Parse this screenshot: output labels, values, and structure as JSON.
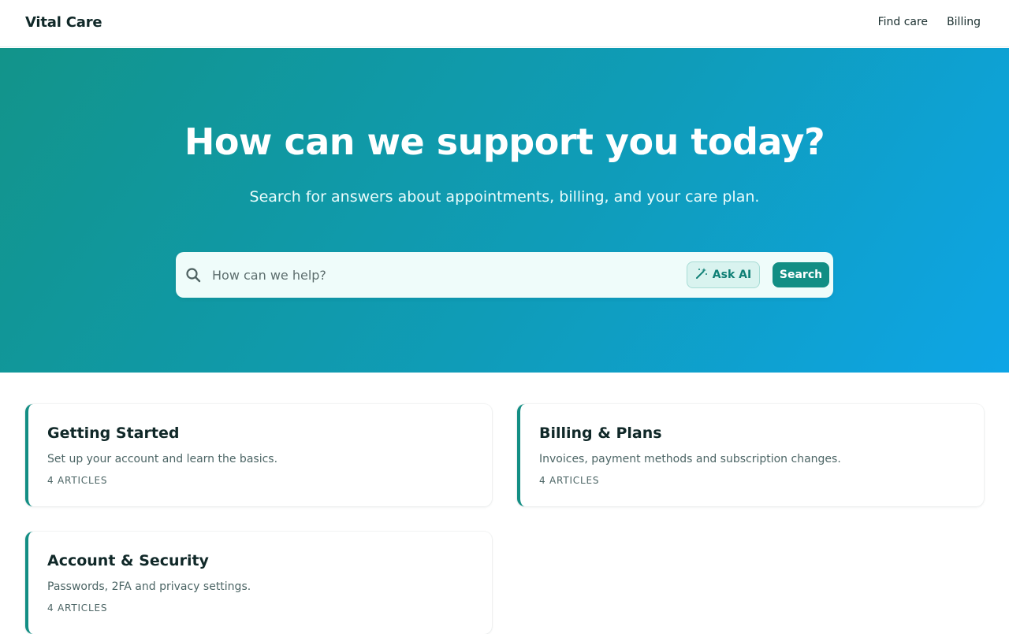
{
  "header": {
    "brand": "Vital Care",
    "nav": [
      {
        "label": "Find care"
      },
      {
        "label": "Billing"
      }
    ]
  },
  "hero": {
    "title": "How can we support you today?",
    "subtitle": "Search for answers about appointments, billing, and your care plan.",
    "search": {
      "placeholder": "How can we help?",
      "value": "",
      "ask_ai_label": "Ask AI",
      "search_label": "Search"
    }
  },
  "categories": [
    {
      "title": "Getting Started",
      "description": "Set up your account and learn the basics.",
      "count": "4 ARTICLES"
    },
    {
      "title": "Billing & Plans",
      "description": "Invoices, payment methods and subscription changes.",
      "count": "4 ARTICLES"
    },
    {
      "title": "Account & Security",
      "description": "Passwords, 2FA and privacy settings.",
      "count": "4 ARTICLES"
    }
  ],
  "colors": {
    "accent": "#128e84",
    "hero_gradient_start": "#12948a",
    "hero_gradient_end": "#0ea5e6"
  }
}
